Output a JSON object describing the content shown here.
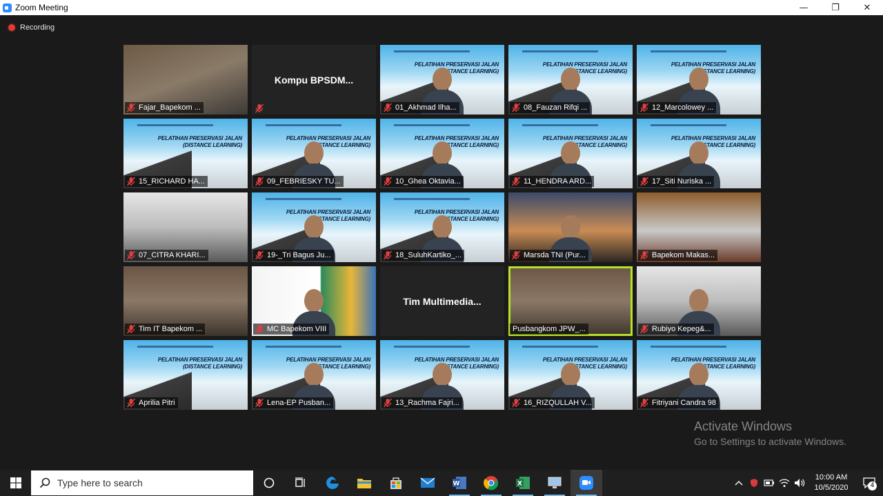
{
  "window": {
    "title": "Zoom Meeting",
    "minimize": "—",
    "maximize": "❐",
    "close": "✕"
  },
  "meeting": {
    "recording_label": "Recording"
  },
  "tiles": [
    {
      "name": "Fajar_Bapekom ...",
      "bg": "photo",
      "muted": true
    },
    {
      "name": "",
      "center": "Kompu  BPSDM...",
      "bg": "dark",
      "muted": true
    },
    {
      "name": "01_Akhmad Ilha...",
      "bg": "slide",
      "muted": true,
      "person": true
    },
    {
      "name": "08_Fauzan Rifqi ...",
      "bg": "slide",
      "muted": true,
      "person": true
    },
    {
      "name": "12_Marcolowey ...",
      "bg": "slide",
      "muted": true,
      "person": true
    },
    {
      "name": "15_RICHARD HA...",
      "bg": "slide",
      "muted": true
    },
    {
      "name": "09_FEBRIESKY TU...",
      "bg": "slide",
      "muted": true,
      "person": true
    },
    {
      "name": "10_Ghea Oktavia...",
      "bg": "slide",
      "muted": true,
      "person": true
    },
    {
      "name": "11_HENDRA ARD...",
      "bg": "slide",
      "muted": true,
      "person": true
    },
    {
      "name": "17_Siti Nuriska ...",
      "bg": "slide",
      "muted": true,
      "person": true
    },
    {
      "name": "07_CITRA KHARI...",
      "bg": "window",
      "muted": true
    },
    {
      "name": "19-_Tri Bagus Ju...",
      "bg": "slide",
      "muted": true,
      "person": true
    },
    {
      "name": "18_SuluhKartiko_...",
      "bg": "slide",
      "muted": true,
      "person": true
    },
    {
      "name": "Marsda TNI (Pur...",
      "bg": "sunset",
      "muted": true,
      "person": true
    },
    {
      "name": "Bapekom Makas...",
      "bg": "room",
      "muted": true
    },
    {
      "name": "Tim IT Bapekom ...",
      "bg": "office",
      "muted": true
    },
    {
      "name": "MC Bapekom VIII",
      "bg": "iprov",
      "muted": true,
      "person": true
    },
    {
      "name": "",
      "center": "Tim  Multimedia...",
      "bg": "dark",
      "muted": false
    },
    {
      "name": "Pusbangkom JPW_...",
      "bg": "office",
      "muted": false,
      "active": true
    },
    {
      "name": "Rubiyo Kepeg&...",
      "bg": "window",
      "muted": true,
      "person": true
    },
    {
      "name": "Aprilia Pitri",
      "bg": "slide",
      "muted": true
    },
    {
      "name": "Lena-EP Pusban...",
      "bg": "slide",
      "muted": true,
      "person": true
    },
    {
      "name": "13_Rachma Fajri...",
      "bg": "slide",
      "muted": true,
      "person": true
    },
    {
      "name": "16_RIZQULLAH V...",
      "bg": "slide",
      "muted": true,
      "person": true
    },
    {
      "name": "Fitriyani Candra 98",
      "bg": "slide",
      "muted": true,
      "person": true
    }
  ],
  "slide_text": "PELATIHAN PRESERVASI JALAN\n(DISTANCE LEARNING)",
  "watermark": {
    "line1": "Activate Windows",
    "line2": "Go to Settings to activate Windows."
  },
  "taskbar": {
    "search_placeholder": "Type here to search",
    "time": "10:00 AM",
    "date": "10/5/2020",
    "notifications": "4"
  },
  "colors": {
    "accent": "#2d8cff",
    "recording": "#e03a3a",
    "active_speaker": "#b8e02a",
    "muted_mic": "#e04040"
  }
}
